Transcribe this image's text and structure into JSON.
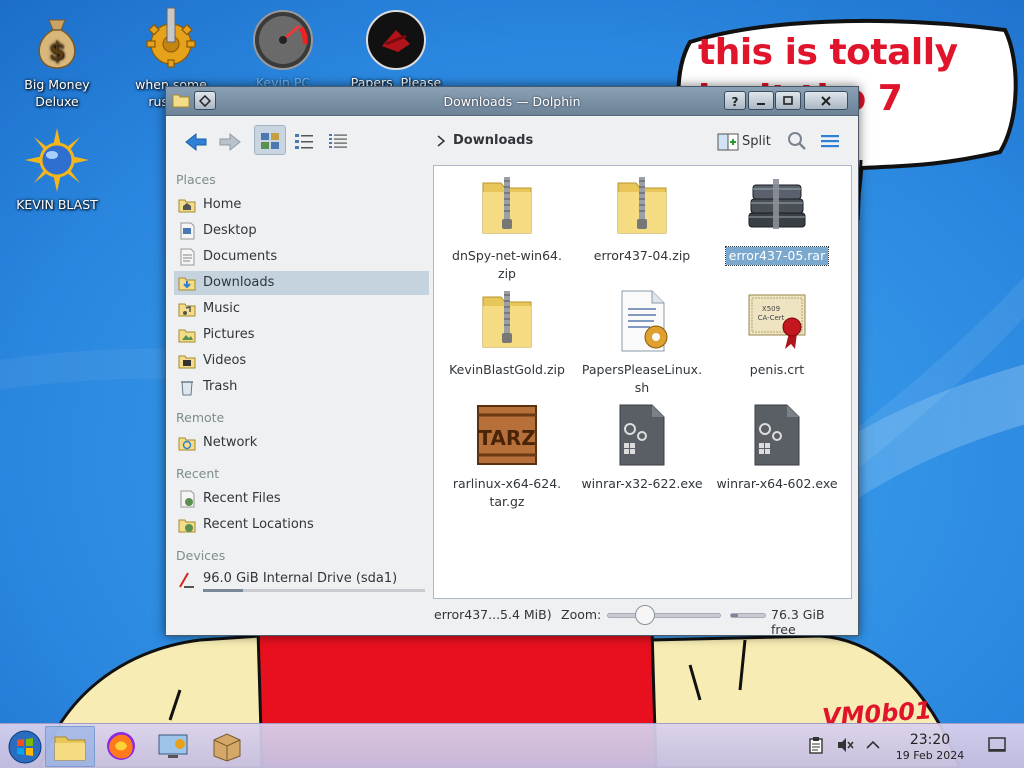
{
  "bubble": {
    "text": "this is totally legit tho 7 guys",
    "line1": "this is totally",
    "line2": "legit tho 7 guys"
  },
  "signature": "VM0b01",
  "desktop_icons": [
    {
      "label": "Big Money Deluxe",
      "icon": "money-bag-icon"
    },
    {
      "label": "when some russian",
      "icon": "gear-icon"
    },
    {
      "label": "Kevin PC Optimizer Pro",
      "icon": "gauge-icon"
    },
    {
      "label": "Papers, Please",
      "icon": "papers-please-icon"
    },
    {
      "label": "KEVIN BLAST",
      "icon": "blast-icon"
    }
  ],
  "window": {
    "title": "Downloads — Dolphin",
    "breadcrumb": "Downloads",
    "split_label": "Split"
  },
  "places": {
    "sections": {
      "places": "Places",
      "remote": "Remote",
      "recent": "Recent",
      "devices": "Devices"
    },
    "items": [
      {
        "label": "Home",
        "icon": "home-folder-icon"
      },
      {
        "label": "Desktop",
        "icon": "desktop-folder-icon"
      },
      {
        "label": "Documents",
        "icon": "documents-folder-icon"
      },
      {
        "label": "Downloads",
        "icon": "downloads-folder-icon",
        "selected": true
      },
      {
        "label": "Music",
        "icon": "music-folder-icon"
      },
      {
        "label": "Pictures",
        "icon": "pictures-folder-icon"
      },
      {
        "label": "Videos",
        "icon": "videos-folder-icon"
      },
      {
        "label": "Trash",
        "icon": "trash-icon"
      }
    ],
    "remote": [
      {
        "label": "Network",
        "icon": "network-folder-icon"
      }
    ],
    "recent": [
      {
        "label": "Recent Files",
        "icon": "recent-files-icon"
      },
      {
        "label": "Recent Locations",
        "icon": "recent-locations-icon"
      }
    ],
    "devices": [
      {
        "label": "96.0 GiB Internal Drive (sda1)",
        "icon": "hard-drive-icon",
        "usage": 0.18
      }
    ]
  },
  "files": [
    {
      "name": "dnSpy-net-win64.zip",
      "line1": "dnSpy-net-win64.",
      "line2": "zip",
      "icon": "zip-folder-icon"
    },
    {
      "name": "error437-04.zip",
      "line1": "error437-04.zip",
      "line2": "",
      "icon": "zip-folder-icon"
    },
    {
      "name": "error437-05.rar",
      "line1": "error437-05.rar",
      "line2": "",
      "icon": "rar-archive-icon",
      "selected": true
    },
    {
      "name": "KevinBlastGold.zip",
      "line1": "KevinBlastGold.zip",
      "line2": "",
      "icon": "zip-folder-icon"
    },
    {
      "name": "PapersPleaseLinux.sh",
      "line1": "PapersPleaseLinux.",
      "line2": "sh",
      "icon": "shell-script-icon"
    },
    {
      "name": "penis.crt",
      "line1": "penis.crt",
      "line2": "",
      "icon": "certificate-icon"
    },
    {
      "name": "rarlinux-x64-624.tar.gz",
      "line1": "rarlinux-x64-624.",
      "line2": "tar.gz",
      "icon": "tarz-archive-icon"
    },
    {
      "name": "winrar-x32-622.exe",
      "line1": "winrar-x32-622.exe",
      "line2": "",
      "icon": "executable-icon"
    },
    {
      "name": "winrar-x64-602.exe",
      "line1": "winrar-x64-602.exe",
      "line2": "",
      "icon": "executable-icon"
    }
  ],
  "statusbar": {
    "file": "error437...5.4 MiB)",
    "zoom_label": "Zoom:",
    "zoom_level": 0.3,
    "free_space": "76.3 GiB free",
    "free_fraction": 0.2
  },
  "taskbar": {
    "clock_time": "23:20",
    "clock_date": "19 Feb 2024",
    "apps": [
      "start-menu-icon",
      "dolphin-folder-icon",
      "firefox-icon",
      "system-settings-icon",
      "package-icon"
    ]
  }
}
